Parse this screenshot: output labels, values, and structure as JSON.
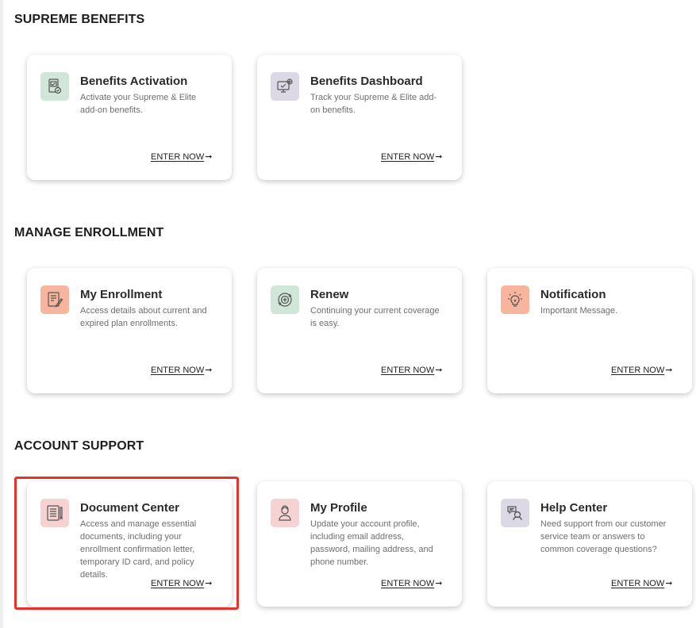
{
  "sections": [
    {
      "title": "SUPREME BENEFITS",
      "cards": [
        {
          "title": "Benefits Activation",
          "desc": "Activate your Supreme & Elite add-on benefits.",
          "link": "ENTER NOW",
          "icon": "tablet-check-icon",
          "color": "#cfe6d8"
        },
        {
          "title": "Benefits Dashboard",
          "desc": "Track your Supreme & Elite add-on benefits.",
          "link": "ENTER NOW",
          "icon": "monitor-gear-icon",
          "color": "#dcd8e6"
        }
      ]
    },
    {
      "title": "MANAGE ENROLLMENT",
      "cards": [
        {
          "title": "My Enrollment",
          "desc": "Access details about current and expired plan enrollments.",
          "link": "ENTER NOW",
          "icon": "form-pencil-icon",
          "color": "#f6b59c"
        },
        {
          "title": "Renew",
          "desc": "Continuing your current coverage is easy.",
          "link": "ENTER NOW",
          "icon": "renew-cycle-icon",
          "color": "#cfe6d8"
        },
        {
          "title": "Notification",
          "desc": "Important Message.",
          "link": "ENTER NOW",
          "icon": "lightbulb-icon",
          "color": "#f6b59c"
        }
      ]
    },
    {
      "title": "ACCOUNT SUPPORT",
      "cards": [
        {
          "title": "Document Center",
          "desc": "Access and manage essential documents, including your enrollment confirmation letter, temporary ID card, and policy details.",
          "link": "ENTER NOW",
          "icon": "document-icon",
          "color": "#f6d2d2"
        },
        {
          "title": "My Profile",
          "desc": "Update your account profile, including email address, password, mailing address, and phone number.",
          "link": "ENTER NOW",
          "icon": "profile-person-icon",
          "color": "#f6d2d2"
        },
        {
          "title": "Help Center",
          "desc": "Need support from our customer service team or answers to common coverage questions?",
          "link": "ENTER NOW",
          "icon": "support-chat-icon",
          "color": "#dcd8e6"
        }
      ]
    }
  ],
  "arrow_glyph": "➞",
  "highlight_color": "#e8312a"
}
